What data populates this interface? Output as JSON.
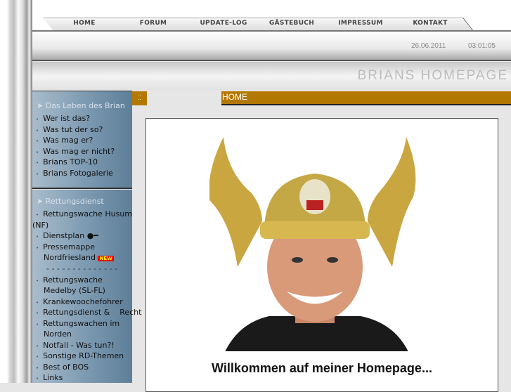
{
  "nav": {
    "tabs": [
      "HOME",
      "FORUM",
      "UPDATE-LOG",
      "GÄSTEBUCH",
      "IMPRESSUM",
      "KONTAKT"
    ]
  },
  "header": {
    "date": "26.06.2011",
    "time": "03:01:05",
    "site_title": "BRIANS HOMEPAGE"
  },
  "sidebar": {
    "section1": {
      "title": "Das Leben des Brian",
      "items": [
        "Wer ist das?",
        "Was tut der so?",
        "Was mag er?",
        "Was mag er nicht?",
        "Brians TOP-10",
        "Brians Fotogalerie"
      ]
    },
    "section2": {
      "title": "Rettungsdienst",
      "items": [
        "Rettungswache    Husum",
        "(NF)",
        "Dienstplan",
        "Pressemappe",
        "Nordfriesland",
        "- - - - - - - - - - - - - -",
        "Rettungswache",
        "Medelby (SL-FL)",
        "Krankewoochefohrer",
        "Rettungsdienst &    Recht",
        "Rettungswachen im",
        "Norden",
        "Notfall - Was tun?!",
        "Sonstige RD-Themen",
        "Best of BOS",
        "Links"
      ],
      "new_badge": "NEW"
    }
  },
  "main": {
    "breadcrumb": "HOME",
    "welcome": "Willkommen auf meiner Homepage..."
  },
  "colors": {
    "accent": "#b37800",
    "sidebar": "#7896ae"
  }
}
